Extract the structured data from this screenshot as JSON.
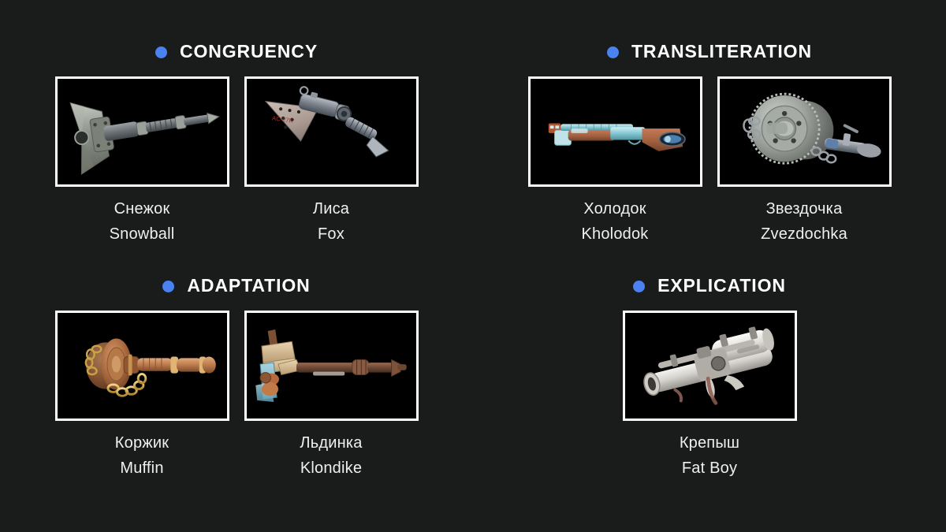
{
  "background_color": "#1a1c1c",
  "accent_color": "#4a82f2",
  "frame_color": "#ffffff",
  "text_color": "#efefef",
  "sections": {
    "congruency": {
      "heading": "CONGRUENCY",
      "bullet_icon": "blue-dot-icon",
      "items": [
        {
          "native": "Снежок",
          "latin": "Snowball",
          "image": "double-bladed-axe-grey-steel"
        },
        {
          "native": "Лиса",
          "latin": "Fox",
          "image": "makeshift-hatchet-pale-blade-red-marks"
        }
      ]
    },
    "transliteration": {
      "heading": "TRANSLITERATION",
      "bullet_icon": "blue-dot-icon",
      "items": [
        {
          "native": "Холодок",
          "latin": "Kholodok",
          "image": "ice-blue-shotgun-wooden-stock"
        },
        {
          "native": "Звездочка",
          "latin": "Zvezdochka",
          "image": "saw-blade-flail-with-chain"
        }
      ]
    },
    "adaptation": {
      "heading": "ADAPTATION",
      "bullet_icon": "blue-dot-icon",
      "items": [
        {
          "native": "Коржик",
          "latin": "Muffin",
          "image": "golden-saw-blade-mace-with-chain"
        },
        {
          "native": "Льдинка",
          "latin": "Klondike",
          "image": "cyan-tan-ice-pickaxe"
        }
      ]
    },
    "explication": {
      "heading": "EXPLICATION",
      "bullet_icon": "blue-dot-icon",
      "items": [
        {
          "native": "Крепыш",
          "latin": "Fat Boy",
          "image": "white-rocket-launcher-bazooka"
        }
      ]
    }
  }
}
